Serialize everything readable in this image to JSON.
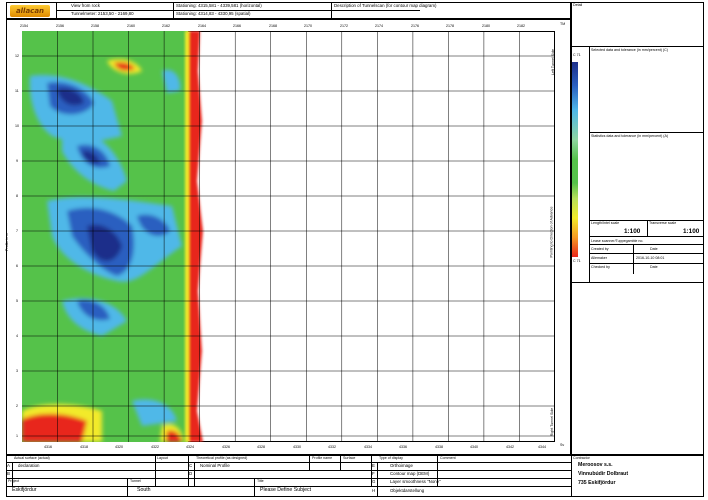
{
  "header": {
    "logo_text": "allacan",
    "view_label": "View from rock",
    "tunnelmeter": "Tunnelmeter: 2153,50 - 2169,80",
    "stationing_h": "Stationing: 4315,581 - 4339,581 (horizontal)",
    "stationing_s": "Stationing: 4314,83 - 4330,95 (spatial)",
    "description": "Description of Tunnelscan (for contour map diagram)",
    "detail": "Detail"
  },
  "plot": {
    "top_ticks": [
      "2154",
      "2156",
      "2158",
      "2160",
      "2162",
      "2164",
      "2166",
      "2168",
      "2170",
      "2172",
      "2174",
      "2176",
      "2178",
      "2180",
      "2182"
    ],
    "bottom_ticks": [
      "4316",
      "4318",
      "4320",
      "4322",
      "4324",
      "4326",
      "4328",
      "4330",
      "4332",
      "4334",
      "4336",
      "4338",
      "4340",
      "4342",
      "4344"
    ],
    "left_ticks": [
      "12",
      "11",
      "10",
      "9",
      "8",
      "7",
      "6",
      "5",
      "4",
      "3",
      "2",
      "1"
    ],
    "left_axis_label": "Profile in m",
    "corner_tm": "TM",
    "corner_sv": "Sv",
    "right_label_top": "Left Tunnel Side",
    "right_label_mid": "Pointing to Direction of Advance",
    "right_label_bottom": "Right Tunnel Side"
  },
  "side": {
    "scale_title": "Selected data and tolerance (in mm/percent) (C)",
    "scale_top": "C 71",
    "scale_bottom": "C 71",
    "legend_title": "Statistics data and tolerance (in mm/percent) (A)",
    "length_scale_label": "Length/Intel scale",
    "length_scale_value": "1:100",
    "transverse_label": "Transverse scale",
    "transverse_value": "1:100",
    "lease_label": "Lease scanner/Tuppegamble no.",
    "created_by_label": "Created by",
    "created_by_value": "Date",
    "date_label": "Allemaker",
    "date_value": "2016-10-10 08:01",
    "checked_label": "Checked by",
    "checked_value": "Date"
  },
  "bottom": {
    "col1_header": "Actual surface (actual)",
    "col2_header": "Layout",
    "col3_header": "Theoretical profile (as designed)",
    "col4_header": "Profile name",
    "col5_header": "Surface",
    "col6_header": "Type of display",
    "col7_header": "Comment",
    "rows": [
      {
        "code": "A",
        "actual": "declaration",
        "code2": "C",
        "theo": "Nominal Profile",
        "code3": "E",
        "display": "Orthoimage"
      },
      {
        "code": "B",
        "actual": "",
        "code2": "D",
        "theo": "",
        "code3": "F",
        "display": "Contour map (DEM)"
      },
      {
        "code": "",
        "actual": "",
        "code2": "",
        "theo": "",
        "code3": "G",
        "display": "Layer smoothness \"None\""
      },
      {
        "code": "",
        "actual": "",
        "code2": "",
        "theo": "",
        "code3": "H",
        "display": "Objektdarstellung"
      }
    ],
    "project_label": "Project",
    "project_value": "Eskifjördur",
    "tunnel_label": "Tunnel",
    "tunnel_value": "South",
    "subject_label": "Title",
    "subject_value": "Please Define Subject",
    "contractor_label": "Contractor",
    "contractor_line1": "Meroosov s.s.",
    "contractor_line2": "Vinnubúdir Dolbraut",
    "contractor_line3": "735 Eskifjördur"
  },
  "colors": {
    "red": "#e8261b",
    "yellow": "#f2ea2a",
    "green": "#55c24a",
    "lightblue": "#4fb8e8",
    "blue": "#2a5fc0",
    "darkblue": "#1d2f8a"
  }
}
